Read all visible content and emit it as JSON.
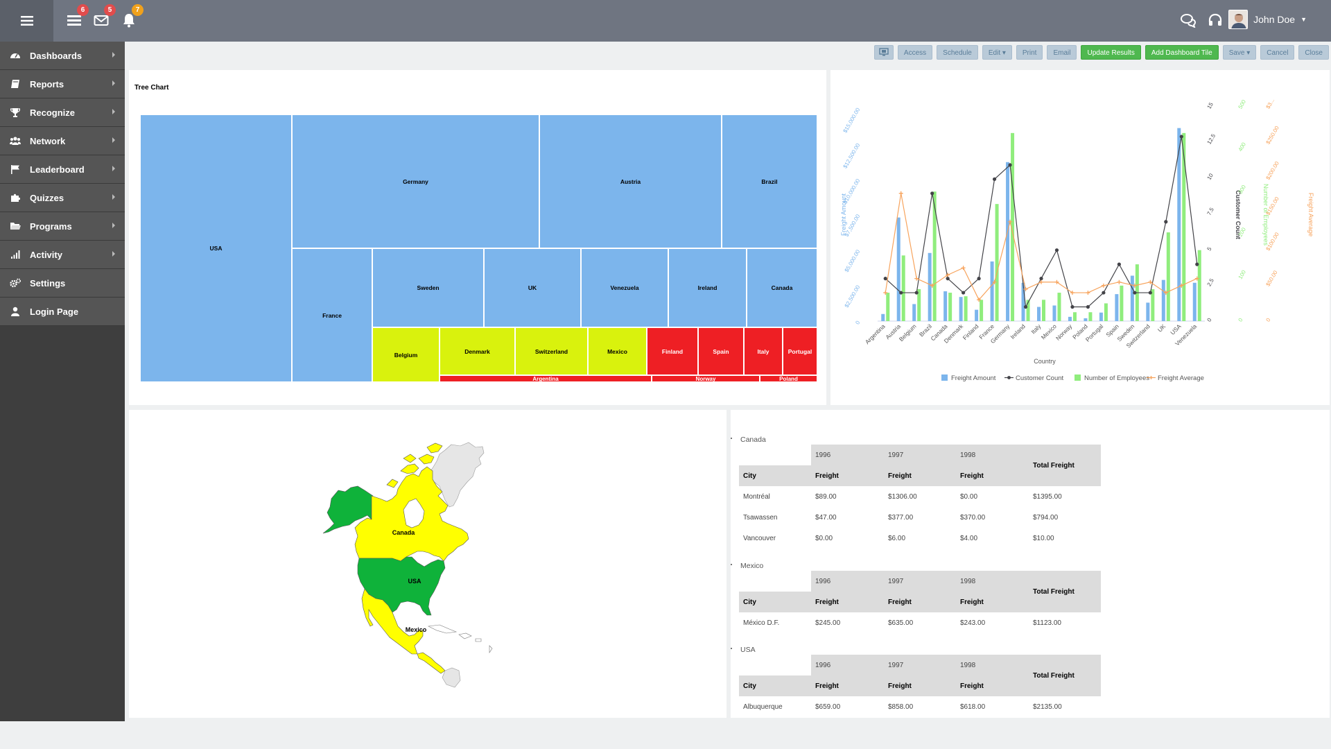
{
  "header": {
    "badges": [
      {
        "name": "list",
        "count": "6",
        "color": "#e14c4c"
      },
      {
        "name": "mail",
        "count": "5",
        "color": "#e14c4c"
      },
      {
        "name": "bell",
        "count": "7",
        "color": "#f0a11c"
      }
    ],
    "user_name": "John Doe"
  },
  "sidebar": {
    "items": [
      {
        "label": "Dashboards",
        "icon": "dashboard-icon"
      },
      {
        "label": "Reports",
        "icon": "book-icon"
      },
      {
        "label": "Recognize",
        "icon": "trophy-icon"
      },
      {
        "label": "Network",
        "icon": "users-icon"
      },
      {
        "label": "Leaderboard",
        "icon": "flag-icon"
      },
      {
        "label": "Quizzes",
        "icon": "puzzle-icon"
      },
      {
        "label": "Programs",
        "icon": "folder-icon"
      },
      {
        "label": "Activity",
        "icon": "signal-icon"
      },
      {
        "label": "Settings",
        "icon": "gears-icon"
      },
      {
        "label": "Login Page",
        "icon": "user-icon"
      }
    ]
  },
  "toolbar": {
    "access": "Access",
    "schedule": "Schedule",
    "edit": "Edit ▾",
    "print": "Print",
    "email": "Email",
    "update": "Update Results",
    "add_tile": "Add Dashboard Tile",
    "save": "Save ▾",
    "cancel": "Cancel",
    "close": "Close"
  },
  "treemap": {
    "title": "Tree Chart",
    "cells": [
      {
        "label": "USA",
        "color": "#7cb5ec"
      },
      {
        "label": "Germany",
        "color": "#7cb5ec"
      },
      {
        "label": "Austria",
        "color": "#7cb5ec"
      },
      {
        "label": "Brazil",
        "color": "#7cb5ec"
      },
      {
        "label": "France",
        "color": "#7cb5ec"
      },
      {
        "label": "Sweden",
        "color": "#7cb5ec"
      },
      {
        "label": "UK",
        "color": "#7cb5ec"
      },
      {
        "label": "Venezuela",
        "color": "#7cb5ec"
      },
      {
        "label": "Ireland",
        "color": "#7cb5ec"
      },
      {
        "label": "Canada",
        "color": "#7cb5ec"
      },
      {
        "label": "Belgium",
        "color": "#d9f20d"
      },
      {
        "label": "Denmark",
        "color": "#d9f20d"
      },
      {
        "label": "Switzerland",
        "color": "#d9f20d"
      },
      {
        "label": "Mexico",
        "color": "#d9f20d"
      },
      {
        "label": "Finland",
        "color": "#ee1f24"
      },
      {
        "label": "Spain",
        "color": "#ee1f24"
      },
      {
        "label": "Italy",
        "color": "#ee1f24"
      },
      {
        "label": "Portugal",
        "color": "#ee1f24"
      },
      {
        "label": "Argentina",
        "color": "#ee1f24"
      },
      {
        "label": "Norway",
        "color": "#ee1f24"
      },
      {
        "label": "Poland",
        "color": "#ee1f24"
      }
    ]
  },
  "chart_data": {
    "type": "bar",
    "xlabel": "Country",
    "categories": [
      "Argentina",
      "Austria",
      "Belgium",
      "Brazil",
      "Canada",
      "Denmark",
      "Finland",
      "France",
      "Germany",
      "Ireland",
      "Italy",
      "Mexico",
      "Norway",
      "Poland",
      "Portugal",
      "Spain",
      "Sweden",
      "Switzerland",
      "UK",
      "USA",
      "Venezuela"
    ],
    "axes": [
      {
        "label": "Freight Amount",
        "color": "#7cb5ec",
        "side": "left",
        "ticks": [
          "0",
          "$2,500.00",
          "$5,000.00",
          "$7,500.00",
          "$10,000.00",
          "$12,500.00",
          "$15,000.00"
        ],
        "max": 15000
      },
      {
        "label": "Customer Count",
        "color": "#434348",
        "side": "right",
        "ticks": [
          "0",
          "2.5",
          "5",
          "7.5",
          "10",
          "12.5",
          "15"
        ],
        "max": 15
      },
      {
        "label": "Number of Employees",
        "color": "#90ed7d",
        "side": "right",
        "ticks": [
          "0",
          "100",
          "200",
          "300",
          "400",
          "500"
        ],
        "max": 600
      },
      {
        "label": "Freight Average",
        "color": "#f7a35c",
        "side": "right",
        "ticks": [
          "0",
          "$50.00",
          "$100.00",
          "$150.00",
          "$200.00",
          "$250.00",
          "$3..."
        ],
        "max": 300
      }
    ],
    "series": [
      {
        "name": "Freight Amount",
        "type": "bar",
        "axis": 0,
        "color": "#7cb5ec",
        "values": [
          500,
          7300,
          1200,
          4800,
          2100,
          1700,
          800,
          4200,
          11200,
          2700,
          1000,
          1100,
          300,
          200,
          600,
          1900,
          3200,
          1300,
          2900,
          13600,
          2700
        ]
      },
      {
        "name": "Customer Count",
        "type": "line",
        "axis": 1,
        "color": "#434348",
        "values": [
          3,
          2,
          2,
          9,
          3,
          2,
          3,
          10,
          11,
          1,
          3,
          5,
          1,
          1,
          2,
          4,
          2,
          2,
          7,
          13,
          4
        ]
      },
      {
        "name": "Number of Employees",
        "type": "bar",
        "axis": 2,
        "color": "#90ed7d",
        "values": [
          80,
          185,
          90,
          365,
          80,
          70,
          60,
          330,
          530,
          60,
          60,
          80,
          25,
          25,
          50,
          100,
          160,
          90,
          250,
          530,
          200
        ]
      },
      {
        "name": "Freight Average",
        "type": "line",
        "axis": 3,
        "color": "#f7a35c",
        "values": [
          40,
          180,
          60,
          50,
          65,
          75,
          30,
          55,
          140,
          45,
          55,
          55,
          40,
          40,
          50,
          55,
          50,
          55,
          40,
          50,
          60
        ]
      }
    ]
  },
  "map": {
    "labels": [
      "Canada",
      "USA",
      "Mexico"
    ],
    "colors": {
      "canada": "#ffff00",
      "usa": "#0fb23a",
      "mexico": "#ffff00",
      "alaska": "#0fb23a",
      "greenland": "#e6e6e6"
    }
  },
  "freight_table": {
    "years": [
      "1996",
      "1997",
      "1998"
    ],
    "city_header": "City",
    "freight_header": "Freight",
    "total_header": "Total Freight",
    "groups": [
      {
        "name": "Canada",
        "rows": [
          {
            "city": "Montréal",
            "v1996": "$89.00",
            "v1997": "$1306.00",
            "v1998": "$0.00",
            "total": "$1395.00"
          },
          {
            "city": "Tsawassen",
            "v1996": "$47.00",
            "v1997": "$377.00",
            "v1998": "$370.00",
            "total": "$794.00"
          },
          {
            "city": "Vancouver",
            "v1996": "$0.00",
            "v1997": "$6.00",
            "v1998": "$4.00",
            "total": "$10.00"
          }
        ]
      },
      {
        "name": "Mexico",
        "rows": [
          {
            "city": "México D.F.",
            "v1996": "$245.00",
            "v1997": "$635.00",
            "v1998": "$243.00",
            "total": "$1123.00"
          }
        ]
      },
      {
        "name": "USA",
        "rows": [
          {
            "city": "Albuquerque",
            "v1996": "$659.00",
            "v1997": "$858.00",
            "v1998": "$618.00",
            "total": "$2135.00"
          }
        ]
      }
    ]
  }
}
